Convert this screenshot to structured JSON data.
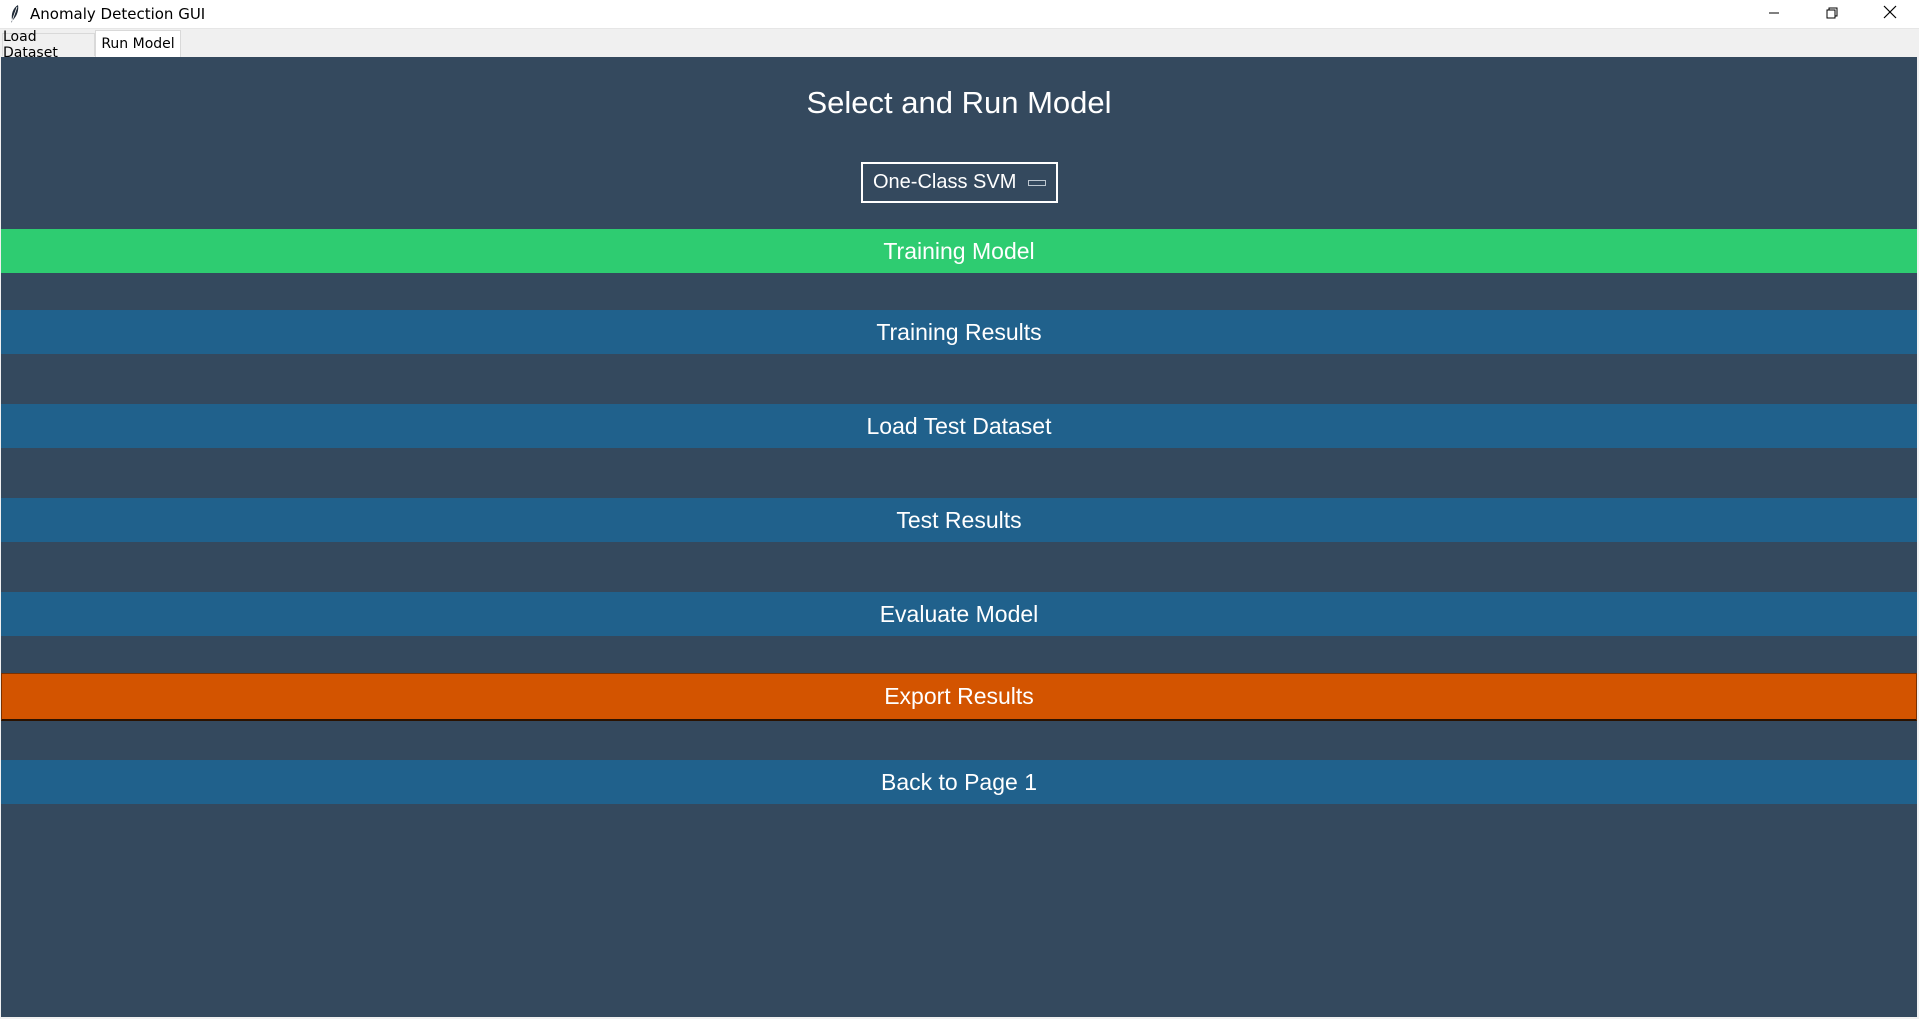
{
  "window": {
    "title": "Anomaly Detection GUI",
    "controls": [
      "minimize-icon",
      "restore-icon",
      "close-icon"
    ]
  },
  "tabs": [
    {
      "label": "Load Dataset",
      "active": false
    },
    {
      "label": "Run Model",
      "active": true
    }
  ],
  "page": {
    "heading": "Select and Run Model",
    "model_select": {
      "value": "One-Class SVM"
    },
    "buttons": {
      "training_model": "Training Model",
      "training_results": "Training Results",
      "load_test_dataset": "Load Test Dataset",
      "test_results": "Test Results",
      "evaluate_model": "Evaluate Model",
      "export_results": "Export Results",
      "back_to_page_1": "Back to Page 1"
    }
  },
  "colors": {
    "background": "#34495e",
    "primary_button": "#20618c",
    "training_button": "#2ecc71",
    "export_button": "#d35400",
    "text": "#ffffff"
  }
}
